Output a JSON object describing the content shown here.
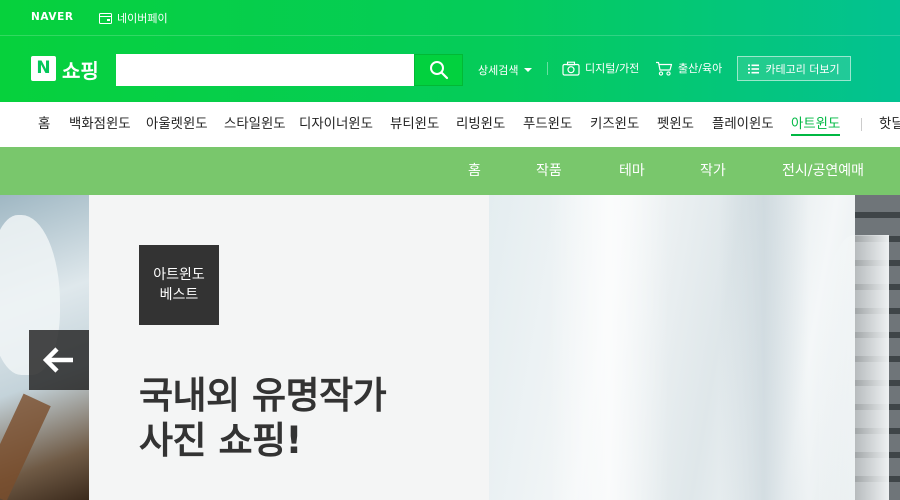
{
  "util": {
    "naver_label": "NAVER",
    "npay_label": "네이버페이"
  },
  "header": {
    "logo_n": "N",
    "logo_text": "쇼핑",
    "search": {
      "value": "",
      "placeholder": ""
    },
    "advanced_search": "상세검색",
    "quick_links": [
      {
        "label": "디지털/가전",
        "icon": "camera-icon"
      },
      {
        "label": "출산/육아",
        "icon": "stroller-icon"
      }
    ],
    "category_button": "카테고리 더보기"
  },
  "nav": {
    "items": [
      {
        "label": "홈"
      },
      {
        "label": "백화점윈도"
      },
      {
        "label": "아울렛윈도"
      },
      {
        "label": "스타일윈도"
      },
      {
        "label": "디자이너윈도"
      },
      {
        "label": "뷰티윈도"
      },
      {
        "label": "리빙윈도"
      },
      {
        "label": "푸드윈도"
      },
      {
        "label": "키즈윈도"
      },
      {
        "label": "펫윈도"
      },
      {
        "label": "플레이윈도"
      },
      {
        "label": "아트윈도",
        "active": true
      },
      {
        "label": "핫딜"
      }
    ]
  },
  "subnav": {
    "items": [
      {
        "label": "홈"
      },
      {
        "label": "작품"
      },
      {
        "label": "테마"
      },
      {
        "label": "작가"
      },
      {
        "label": "전시/공연예매"
      }
    ]
  },
  "hero": {
    "badge_line1": "아트윈도",
    "badge_line2": "베스트",
    "title_line1": "국내외 유명작가",
    "title_line2": "사진 쇼핑!"
  },
  "colors": {
    "brand_green": "#03c75a",
    "active_nav": "#00b843",
    "subnav_bg": "#79c76c"
  }
}
